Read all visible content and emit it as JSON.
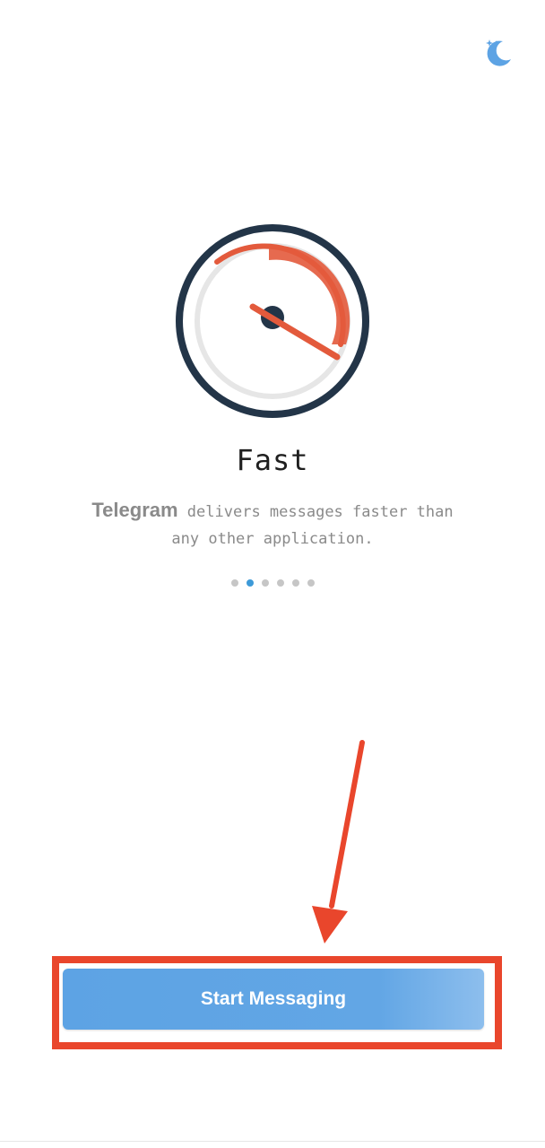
{
  "colors": {
    "accent": "#3d9ad8",
    "button": "#62a6e5",
    "annotation": "#e9462c",
    "gauge_ring": "#233548",
    "gauge_needle": "#e35a3c"
  },
  "header": {
    "theme_toggle_icon": "moon-stars-icon"
  },
  "intro": {
    "illustration_icon": "speedometer-icon",
    "title": "Fast",
    "brand": "Telegram",
    "description_rest": " delivers messages faster than any other application."
  },
  "pager": {
    "count": 6,
    "active_index": 1
  },
  "actions": {
    "start_label": "Start Messaging"
  }
}
